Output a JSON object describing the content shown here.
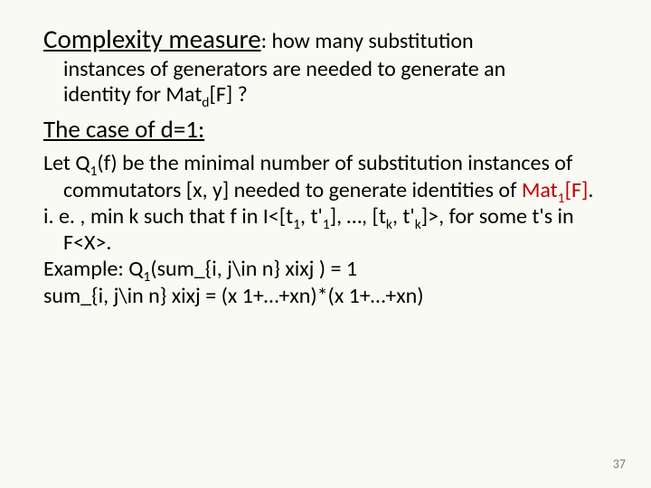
{
  "heading": {
    "title": "Complexity measure",
    "tail_a": ": how many substitution",
    "tail_b_l1": "instances of generators are needed to generate an",
    "tail_b_l2_pre": "identity for Mat",
    "tail_b_l2_sub": "d",
    "tail_b_l2_post": "[F] ?"
  },
  "case_heading": "The case of d=1:",
  "body": {
    "p1_a": "Let Q",
    "p1_sub1": "1",
    "p1_b": "(f) be the minimal number of substitution instances of commutators [x, y] needed to generate identities of ",
    "p1_red_pre": "Mat",
    "p1_red_sub": "1",
    "p1_red_post": "[F]",
    "p1_end": ".",
    "p2_a": "i. e. , min k such that f in I<[t",
    "p2_s1": "1",
    "p2_b": ", t'",
    "p2_s2": "1",
    "p2_c": "], …, [t",
    "p2_s3": "k",
    "p2_d": ", t'",
    "p2_s4": "k",
    "p2_e": "]>, for some t's in F<X>.",
    "p3_a": "Example: Q",
    "p3_sub": "1",
    "p3_b": "(sum_{i, j\\in n} xixj ) = 1",
    "p4": "sum_{i, j\\in n} xixj = (x 1+…+xn)*(x 1+…+xn)"
  },
  "page_number": "37"
}
